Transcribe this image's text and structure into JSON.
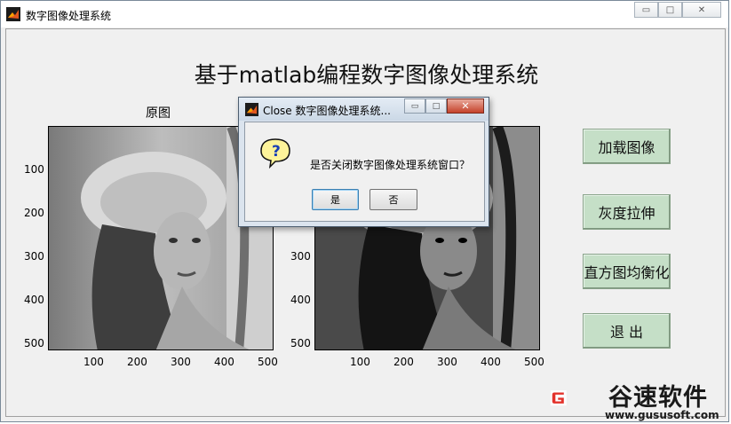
{
  "window": {
    "title": "数字图像处理系统",
    "controls": {
      "minimize": "▭",
      "maximize": "□",
      "close": "✕"
    }
  },
  "main": {
    "title": "基于matlab编程数字图像处理系统",
    "left_axes": {
      "title": "原图",
      "y_ticks": [
        "100",
        "200",
        "300",
        "400",
        "500"
      ],
      "x_ticks": [
        "100",
        "200",
        "300",
        "400",
        "500"
      ]
    },
    "right_axes": {
      "y_ticks": [
        "300",
        "400",
        "500"
      ],
      "x_ticks": [
        "100",
        "200",
        "300",
        "400",
        "500"
      ]
    },
    "buttons": {
      "load": "加载图像",
      "gray_stretch": "灰度拉伸",
      "hist_eq": "直方图均衡化",
      "exit": "退  出"
    }
  },
  "dialog": {
    "title": "Close 数字图像处理系统...",
    "message": "是否关闭数字图像处理系统窗口？",
    "yes": "是",
    "no": "否",
    "icon": "question-icon"
  },
  "watermark": {
    "text": "谷速软件",
    "url": "www.gususoft.com"
  },
  "colors": {
    "side_button": "#c5dfc7",
    "dialog_close": "#c4422b",
    "watermark_red": "#e3322b"
  }
}
